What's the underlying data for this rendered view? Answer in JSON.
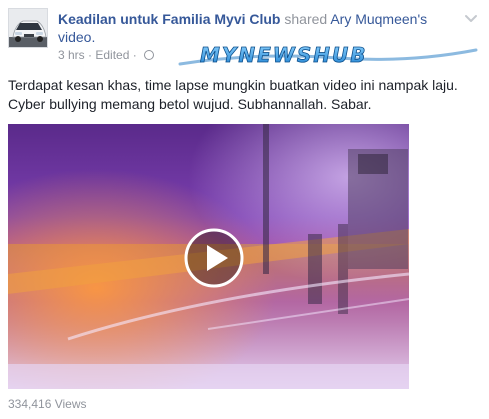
{
  "post": {
    "author": "Keadilan untuk Familia Myvi Club",
    "action": "shared",
    "shared_from": "Ary Muqmeen's video.",
    "time": "3 hrs",
    "edited": "Edited",
    "separator": "·",
    "watermark": "MYNEWSHUB",
    "text": "Terdapat kesan khas, time lapse mungkin buatkan video ini nampak laju.\nCyber bullying memang betol wujud. Subhannallah. Sabar.",
    "views": "334,416 Views"
  },
  "icons": {
    "avatar": "car-avatar-icon",
    "privacy": "globe-icon",
    "menu": "chevron-down-icon",
    "play": "play-icon"
  },
  "colors": {
    "link": "#365899",
    "meta": "#90949c",
    "text": "#1d2129"
  }
}
